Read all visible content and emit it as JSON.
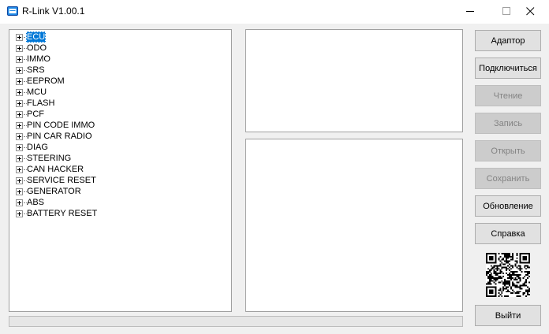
{
  "window": {
    "title": "R-Link  V1.00.1",
    "controls": [
      "minimize-icon",
      "maximize-icon",
      "close-icon"
    ]
  },
  "tree": {
    "selected_index": 0,
    "items": [
      {
        "label": "ECU"
      },
      {
        "label": "ODO"
      },
      {
        "label": "IMMO"
      },
      {
        "label": "SRS"
      },
      {
        "label": "EEPROM"
      },
      {
        "label": "MCU"
      },
      {
        "label": "FLASH"
      },
      {
        "label": "PCF"
      },
      {
        "label": "PIN CODE IMMO"
      },
      {
        "label": "PIN CAR RADIO"
      },
      {
        "label": "DIAG"
      },
      {
        "label": "STEERING"
      },
      {
        "label": "CAN HACKER"
      },
      {
        "label": "SERVICE RESET"
      },
      {
        "label": "GENERATOR"
      },
      {
        "label": "ABS"
      },
      {
        "label": "BATTERY RESET"
      }
    ]
  },
  "buttons": {
    "adapter": {
      "label": "Адаптор",
      "enabled": true
    },
    "connect": {
      "label": "Подключиться",
      "enabled": true
    },
    "read": {
      "label": "Чтение",
      "enabled": false
    },
    "write": {
      "label": "Запись",
      "enabled": false
    },
    "open": {
      "label": "Открыть",
      "enabled": false
    },
    "save": {
      "label": "Сохранить",
      "enabled": false
    },
    "update": {
      "label": "Обновление",
      "enabled": true
    },
    "help": {
      "label": "Справка",
      "enabled": true
    },
    "exit": {
      "label": "Выйти",
      "enabled": true
    }
  },
  "progress": {
    "fraction": 0
  },
  "colors": {
    "selection": "#0078d7",
    "window_bg": "#f0f0f0",
    "disabled_button": "#cccccc",
    "progress_fill": "#06b025"
  }
}
